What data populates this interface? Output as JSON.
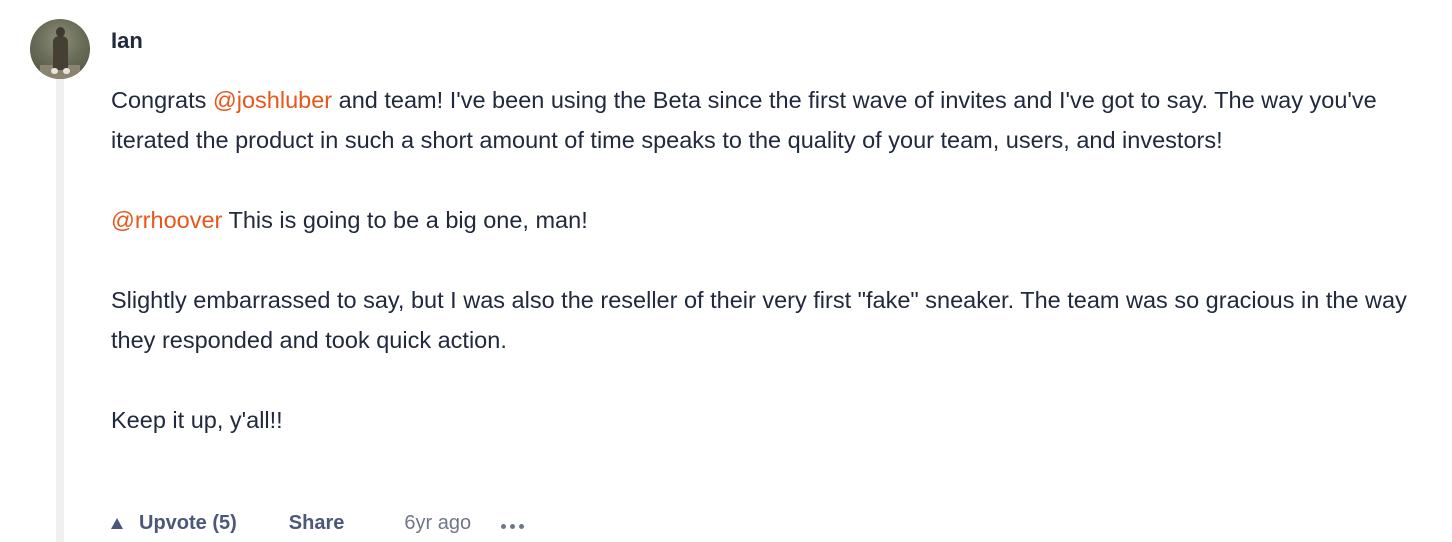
{
  "comment": {
    "author": "Ian",
    "paragraphs": [
      {
        "segments": [
          {
            "text": "Congrats ",
            "type": "text"
          },
          {
            "text": "@joshluber",
            "type": "mention"
          },
          {
            "text": " and team! I've been using the Beta since the first wave of invites and I've got to say. The way you've iterated the product in such a short amount of time speaks to the quality of your team, users, and investors!",
            "type": "text"
          }
        ]
      },
      {
        "segments": [
          {
            "text": "@rrhoover",
            "type": "mention"
          },
          {
            "text": " This is going to be a big one, man!",
            "type": "text"
          }
        ]
      },
      {
        "segments": [
          {
            "text": "Slightly embarrassed to say, but I was also the reseller of their very first \"fake\" sneaker. The team was so gracious in the way they responded and took quick action.",
            "type": "text"
          }
        ]
      },
      {
        "segments": [
          {
            "text": "Keep it up, y'all!!",
            "type": "text"
          }
        ]
      }
    ],
    "actions": {
      "upvote_label": "Upvote (5)",
      "share_label": "Share",
      "timestamp": "6yr ago",
      "more_icon": "more-horizontal-icon",
      "upvote_icon": "triangle-up-icon"
    }
  },
  "colors": {
    "text": "#21293c",
    "mention": "#e8561a",
    "action": "#4b587c",
    "muted": "#6f7787",
    "thread_line": "#f0f0f0"
  }
}
